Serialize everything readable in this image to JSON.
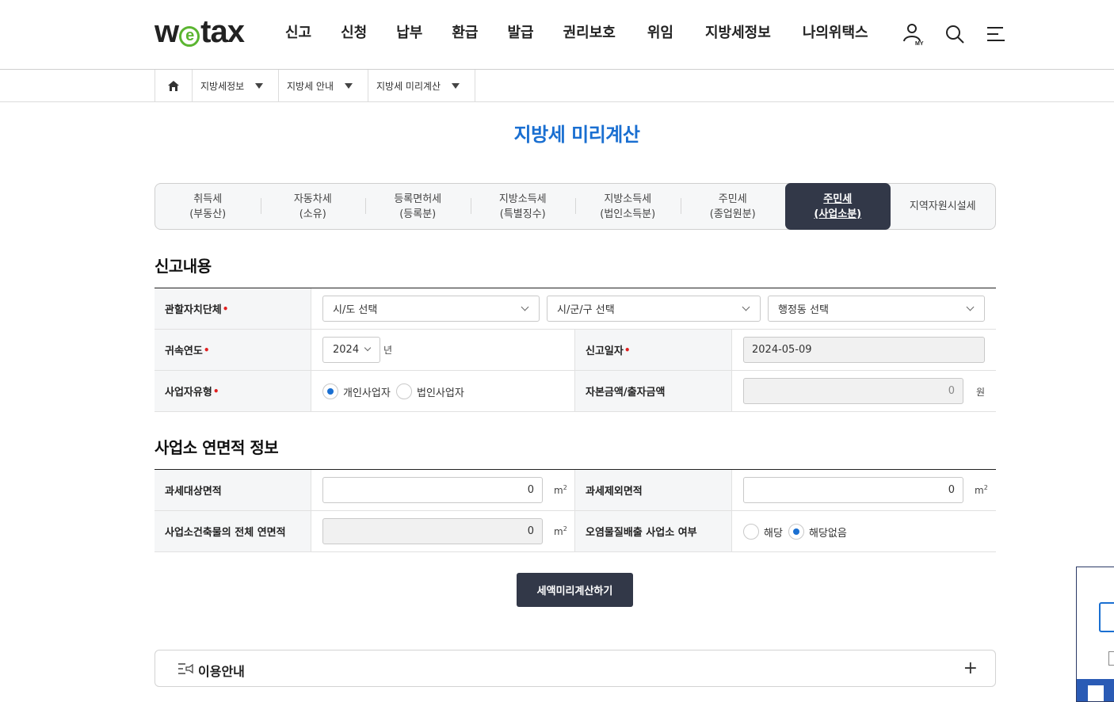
{
  "header": {
    "logo": {
      "pre": "w",
      "mid": "e",
      "post": "tax"
    },
    "nav": [
      "신고",
      "신청",
      "납부",
      "환급",
      "발급",
      "권리보호",
      "위임",
      "지방세정보",
      "나의위택스"
    ],
    "icons": [
      "my-user-icon",
      "search-icon",
      "menu-icon"
    ],
    "my_badge": "MY"
  },
  "breadcrumb": {
    "items": [
      "지방세정보",
      "지방세 안내",
      "지방세 미리계산"
    ]
  },
  "page_title": "지방세 미리계산",
  "tabs": [
    {
      "l1": "취득세",
      "l2": "(부동산)"
    },
    {
      "l1": "자동차세",
      "l2": "(소유)"
    },
    {
      "l1": "등록면허세",
      "l2": "(등록분)"
    },
    {
      "l1": "지방소득세",
      "l2": "(특별징수)"
    },
    {
      "l1": "지방소득세",
      "l2": "(법인소득분)"
    },
    {
      "l1": "주민세",
      "l2": "(종업원분)"
    },
    {
      "l1": "주민세",
      "l2": "(사업소분)"
    },
    {
      "l1": "지역자원시설세",
      "l2": ""
    }
  ],
  "active_tab": "주민세(사업소분)",
  "report": {
    "section_title": "신고내용",
    "jurisdiction": {
      "label": "관할자치단체",
      "sido": "시/도 선택",
      "sigungu": "시/군/구 선택",
      "dong": "행정동 선택"
    },
    "year": {
      "label": "귀속연도",
      "value": "2024",
      "unit": "년"
    },
    "report_date": {
      "label": "신고일자",
      "value": "2024-05-09"
    },
    "biz_type": {
      "label": "사업자유형",
      "options": [
        "개인사업자",
        "법인사업자"
      ],
      "selected": "개인사업자"
    },
    "capital": {
      "label": "자본금액/출자금액",
      "value": "0",
      "unit": "원"
    }
  },
  "area": {
    "section_title": "사업소 연면적 정보",
    "taxable": {
      "label": "과세대상면적",
      "value": "0",
      "unit": "m",
      "unit_sup": "2"
    },
    "excluded": {
      "label": "과세제외면적",
      "value": "0",
      "unit": "m",
      "unit_sup": "2"
    },
    "total": {
      "label": "사업소건축물의 전체 연면적",
      "value": "0",
      "unit": "m",
      "unit_sup": "2"
    },
    "pollution": {
      "label": "오염물질배출 사업소 여부",
      "options": [
        "해당",
        "해당없음"
      ],
      "selected": "해당없음"
    }
  },
  "calc_button": "세액미리계산하기",
  "info": {
    "label": "이용안내",
    "toggle": "+"
  },
  "colors": {
    "accent": "#1a6fd1",
    "dark": "#323848",
    "logo_green": "#5bb531",
    "required": "#e12020"
  }
}
